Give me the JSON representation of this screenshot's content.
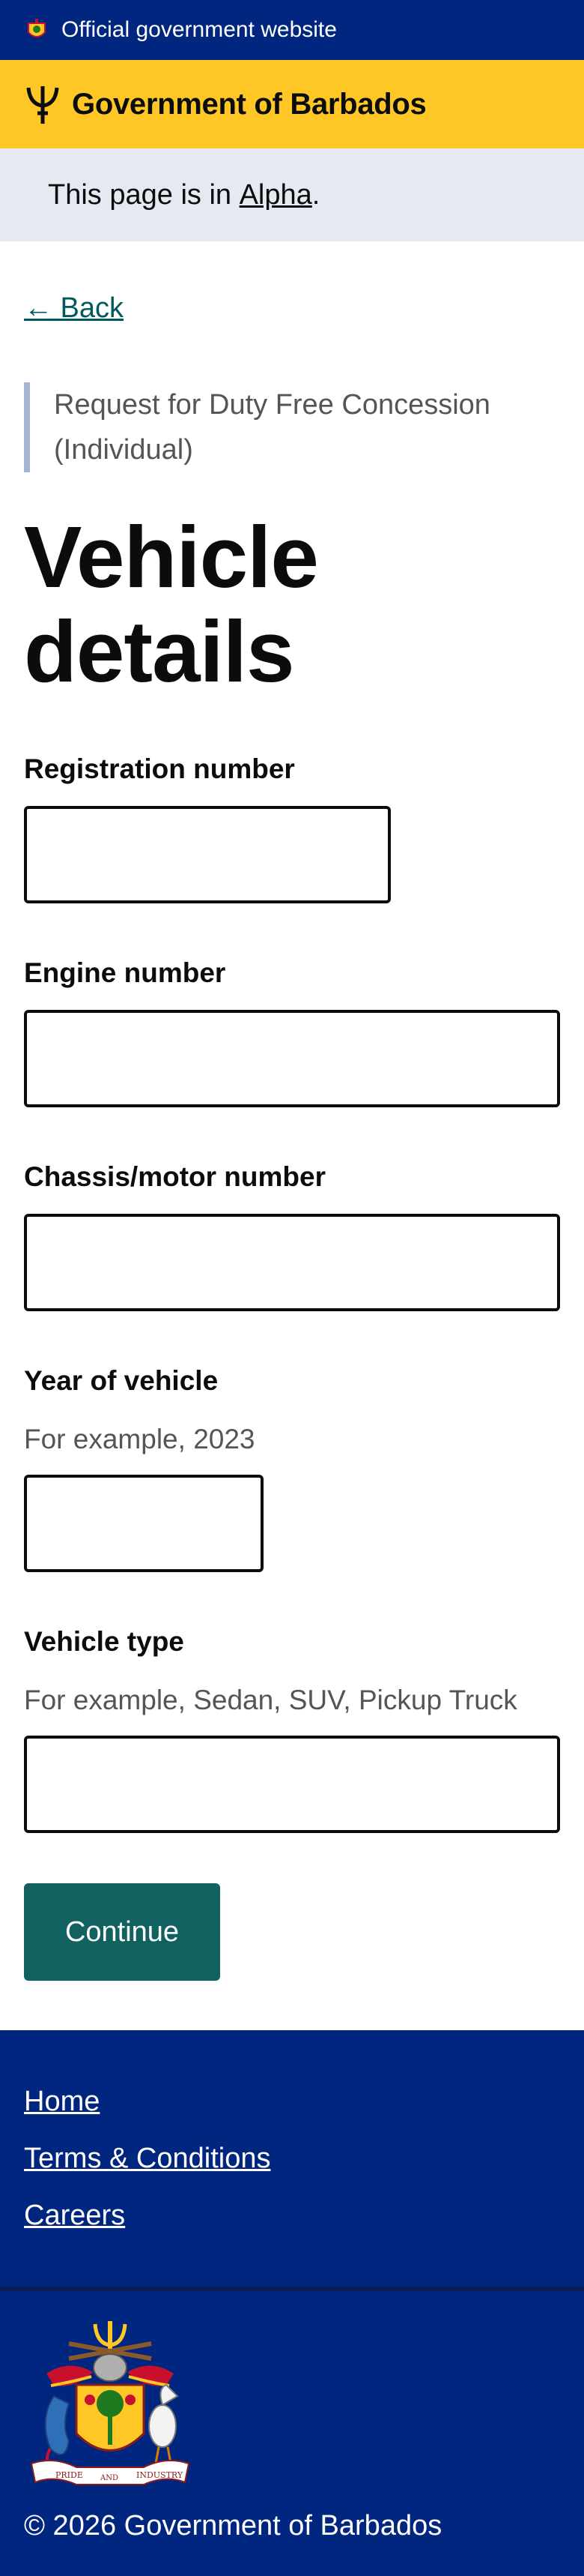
{
  "banner": {
    "text": "Official government website",
    "icon": "barbados-crest-icon"
  },
  "header": {
    "title": "Government of Barbados",
    "icon": "trident-icon"
  },
  "phase": {
    "prefix": "This page is in ",
    "tag": "Alpha",
    "suffix": "."
  },
  "back": {
    "label": "← Back"
  },
  "form": {
    "caption": "Request for Duty Free Concession (Individual)",
    "heading": "Vehicle details",
    "fields": [
      {
        "label": "Registration number",
        "hint": "",
        "value": ""
      },
      {
        "label": "Engine number",
        "hint": "",
        "value": ""
      },
      {
        "label": "Chassis/motor number",
        "hint": "",
        "value": ""
      },
      {
        "label": "Year of vehicle",
        "hint": "For example, 2023",
        "value": ""
      },
      {
        "label": "Vehicle type",
        "hint": "For example, Sedan, SUV, Pickup Truck",
        "value": ""
      }
    ],
    "submit_label": "Continue"
  },
  "footer": {
    "links": [
      "Home",
      "Terms & Conditions",
      "Careers"
    ],
    "coat_of_arms_motto": [
      "PRIDE",
      "AND",
      "INDUSTRY"
    ],
    "copyright": "© 2026 Government of Barbados"
  },
  "colors": {
    "navy": "#00267f",
    "yellow": "#ffc726",
    "teal": "#10615f",
    "phase_bg": "#e5e9f1"
  }
}
